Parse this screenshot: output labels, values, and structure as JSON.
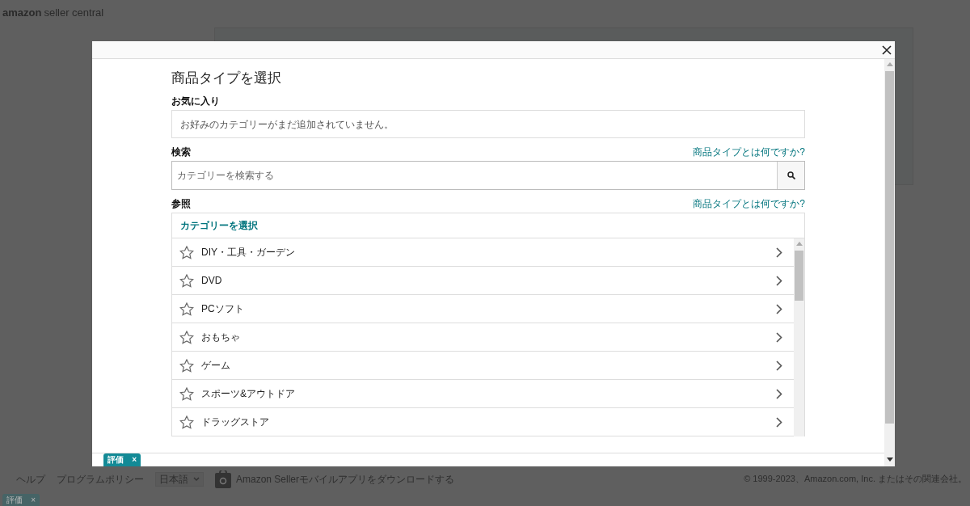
{
  "background_page": {
    "logo": {
      "brand": "amazon",
      "product": "seller central"
    },
    "footer_links": [
      "ヘルプ",
      "プログラムポリシー"
    ],
    "language_select": "日本語",
    "app_download": "Amazon Sellerモバイルアプリをダウンロードする",
    "copyright": "© 1999-2023、Amazon.com, Inc. またはその関連会社。",
    "feedback_tab": "評価",
    "feedback_close": "×"
  },
  "dialog": {
    "title": "商品タイプを選択",
    "favorites": {
      "label": "お気に入り",
      "empty_message": "お好みのカテゴリーがまだ追加されていません。"
    },
    "search": {
      "label": "検索",
      "help_link": "商品タイプとは何ですか?",
      "placeholder": "カテゴリーを検索する"
    },
    "browse": {
      "label": "参照",
      "help_link": "商品タイプとは何ですか?",
      "header": "カテゴリーを選択",
      "categories": [
        {
          "name": "DIY・工具・ガーデン",
          "favorite": false
        },
        {
          "name": "DVD",
          "favorite": false
        },
        {
          "name": "PCソフト",
          "favorite": false
        },
        {
          "name": "おもちゃ",
          "favorite": false
        },
        {
          "name": "ゲーム",
          "favorite": false
        },
        {
          "name": "スポーツ&アウトドア",
          "favorite": false
        },
        {
          "name": "ドラッグストア",
          "favorite": false
        }
      ]
    },
    "feedback_tab": "評価",
    "feedback_close": "×"
  }
}
